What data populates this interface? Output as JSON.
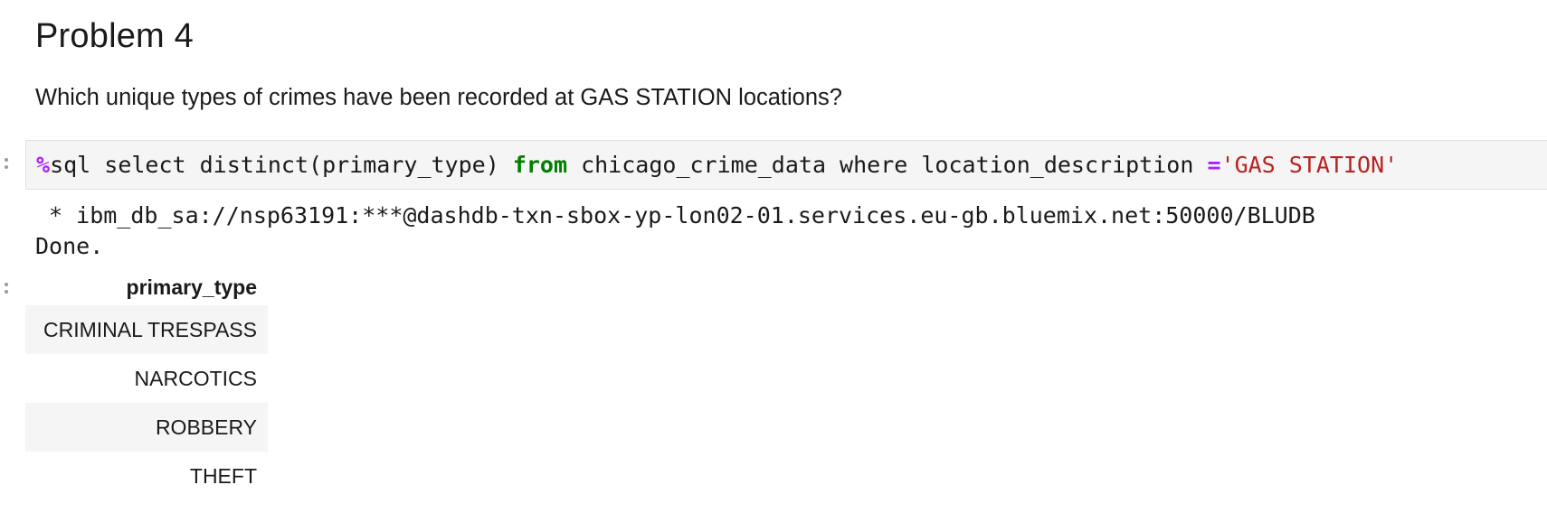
{
  "markdown_cell": {
    "heading": "Problem 4",
    "question": "Which unique types of crimes have been recorded at GAS STATION locations?"
  },
  "code_cell": {
    "magic": "%",
    "code_before_keyword": "sql select distinct(primary_type) ",
    "keyword": "from",
    "code_after_keyword": " chicago_crime_data where location_description ",
    "operator": "=",
    "string_literal": "'GAS STATION'"
  },
  "output": {
    "connection_line": " * ibm_db_sa://nsp63191:***@dashdb-txn-sbox-yp-lon02-01.services.eu-gb.bluemix.net:50000/BLUDB",
    "status_line": "Done.",
    "table": {
      "columns": [
        "primary_type"
      ],
      "rows": [
        [
          "CRIMINAL TRESPASS"
        ],
        [
          "NARCOTICS"
        ],
        [
          "ROBBERY"
        ],
        [
          "THEFT"
        ]
      ]
    }
  },
  "colors": {
    "magic": "#aa22ff",
    "keyword": "#008000",
    "string": "#ba2121",
    "cell_background": "#f5f5f5"
  }
}
